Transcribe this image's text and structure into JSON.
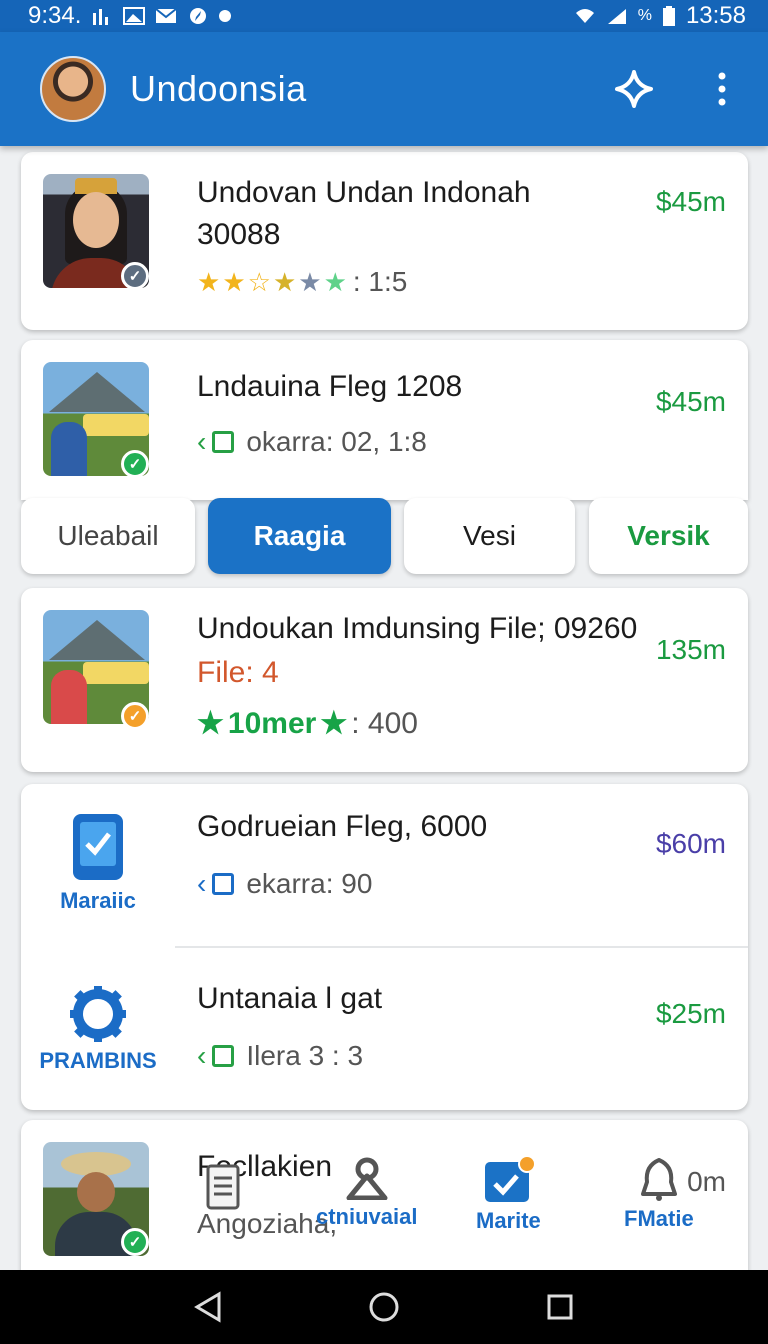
{
  "status_bar": {
    "time": "9:34.",
    "clock": "13:58",
    "signal_text": "%"
  },
  "app_bar": {
    "title": "Undoonsia",
    "accent": "#1b72c6"
  },
  "cards": [
    {
      "title": "Undovan Undan Indonah 30088",
      "price": "$45m",
      "rating_text": ": 1:5"
    },
    {
      "title": "Lndauina Fleg 1208",
      "price": "$45m",
      "meta": "okarra: 02, 1:8"
    }
  ],
  "chips": [
    {
      "label": "Uleabail"
    },
    {
      "label": "Raagia",
      "active": true
    },
    {
      "label": "Vesi"
    },
    {
      "label": "Versik"
    }
  ],
  "card3": {
    "title": "Undoukan Imdunsing File; 09260",
    "price": "135m",
    "file_line": "File: 4",
    "stars_label": "10mer",
    "stars_value": ": 400"
  },
  "card4": {
    "rows": [
      {
        "icon_caption": "Maraiic",
        "title": "Godrueian Fleg, 6000",
        "price": "$60m",
        "meta": "ekarra: 90"
      },
      {
        "icon_caption": "PRAMBINS",
        "title": "Untanaia l gat",
        "price": "$25m",
        "meta": "Ilera 3 : 3"
      }
    ]
  },
  "card5": {
    "title": "Fecllakien",
    "subtitle": "Angoziaha,",
    "price": "0m"
  },
  "bottom_nav": [
    {
      "label": "ctniuvaial"
    },
    {
      "label": "Marite"
    },
    {
      "label": "FMatie"
    }
  ],
  "colors": {
    "green_price": "#1a9a40",
    "purple_price": "#4a3fa8",
    "orange_file": "#d2572c"
  }
}
